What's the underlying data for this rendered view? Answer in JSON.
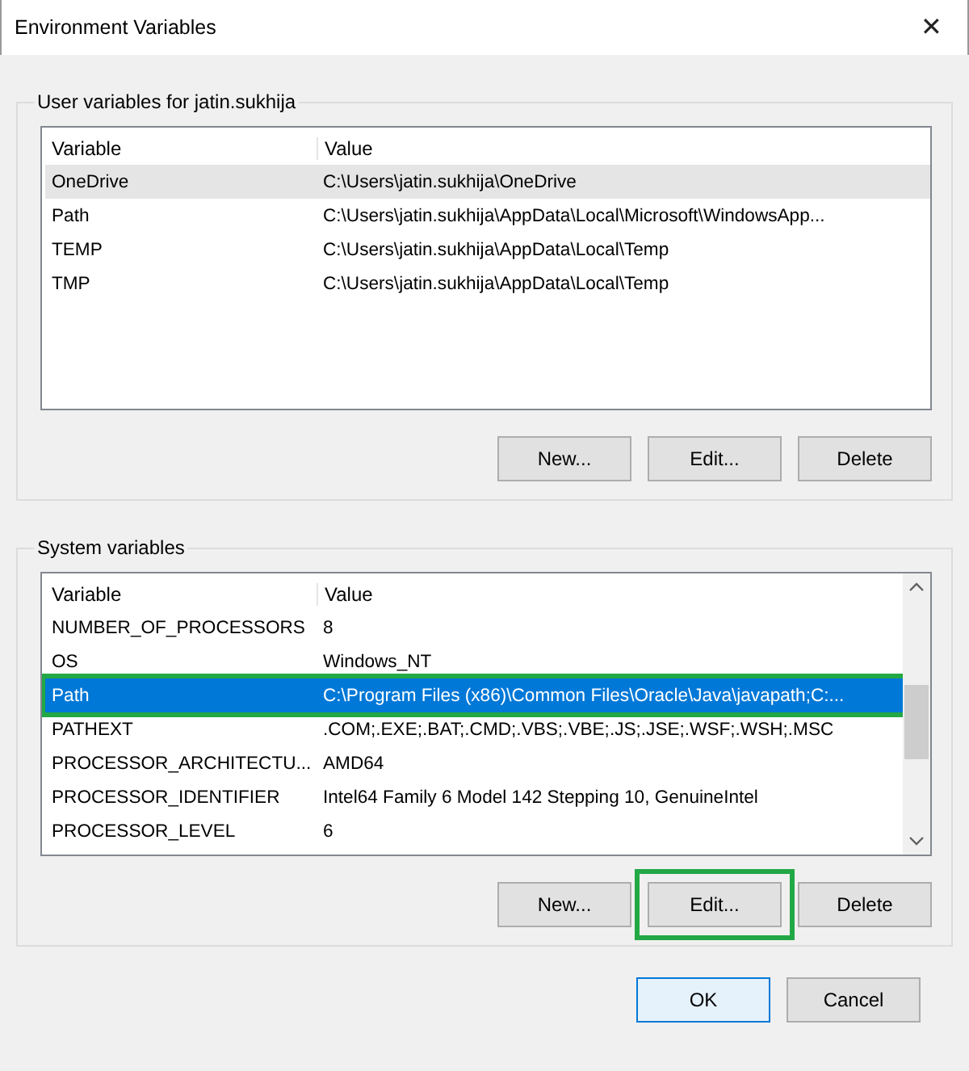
{
  "window": {
    "title": "Environment Variables",
    "close": "✕"
  },
  "user_variables": {
    "title": "User variables for jatin.sukhija",
    "columns": [
      "Variable",
      "Value"
    ],
    "scrollbar": false,
    "rows": [
      {
        "variable": "OneDrive",
        "value": "C:\\Users\\jatin.sukhija\\OneDrive",
        "selected": false,
        "hovered": true,
        "highlighted": false
      },
      {
        "variable": "Path",
        "value": "C:\\Users\\jatin.sukhija\\AppData\\Local\\Microsoft\\WindowsApp...",
        "selected": false,
        "hovered": false,
        "highlighted": false
      },
      {
        "variable": "TEMP",
        "value": "C:\\Users\\jatin.sukhija\\AppData\\Local\\Temp",
        "selected": false,
        "hovered": false,
        "highlighted": false
      },
      {
        "variable": "TMP",
        "value": "C:\\Users\\jatin.sukhija\\AppData\\Local\\Temp",
        "selected": false,
        "hovered": false,
        "highlighted": false
      }
    ],
    "buttons": [
      {
        "label": "New...",
        "highlighted": false
      },
      {
        "label": "Edit...",
        "highlighted": false
      },
      {
        "label": "Delete",
        "highlighted": false
      }
    ]
  },
  "system_variables": {
    "title": "System variables",
    "columns": [
      "Variable",
      "Value"
    ],
    "scrollbar": true,
    "rows": [
      {
        "variable": "NUMBER_OF_PROCESSORS",
        "value": "8",
        "selected": false,
        "hovered": false,
        "highlighted": false
      },
      {
        "variable": "OS",
        "value": "Windows_NT",
        "selected": false,
        "hovered": false,
        "highlighted": false
      },
      {
        "variable": "Path",
        "value": "C:\\Program Files (x86)\\Common Files\\Oracle\\Java\\javapath;C:...",
        "selected": true,
        "hovered": false,
        "highlighted": true
      },
      {
        "variable": "PATHEXT",
        "value": ".COM;.EXE;.BAT;.CMD;.VBS;.VBE;.JS;.JSE;.WSF;.WSH;.MSC",
        "selected": false,
        "hovered": false,
        "highlighted": false
      },
      {
        "variable": "PROCESSOR_ARCHITECTU...",
        "value": "AMD64",
        "selected": false,
        "hovered": false,
        "highlighted": false
      },
      {
        "variable": "PROCESSOR_IDENTIFIER",
        "value": "Intel64 Family 6 Model 142 Stepping 10, GenuineIntel",
        "selected": false,
        "hovered": false,
        "highlighted": false
      },
      {
        "variable": "PROCESSOR_LEVEL",
        "value": "6",
        "selected": false,
        "hovered": false,
        "highlighted": false
      }
    ],
    "buttons": [
      {
        "label": "New...",
        "highlighted": false
      },
      {
        "label": "Edit...",
        "highlighted": true
      },
      {
        "label": "Delete",
        "highlighted": false
      }
    ]
  },
  "footer_buttons": [
    {
      "label": "OK",
      "default": true
    },
    {
      "label": "Cancel",
      "default": false
    }
  ]
}
